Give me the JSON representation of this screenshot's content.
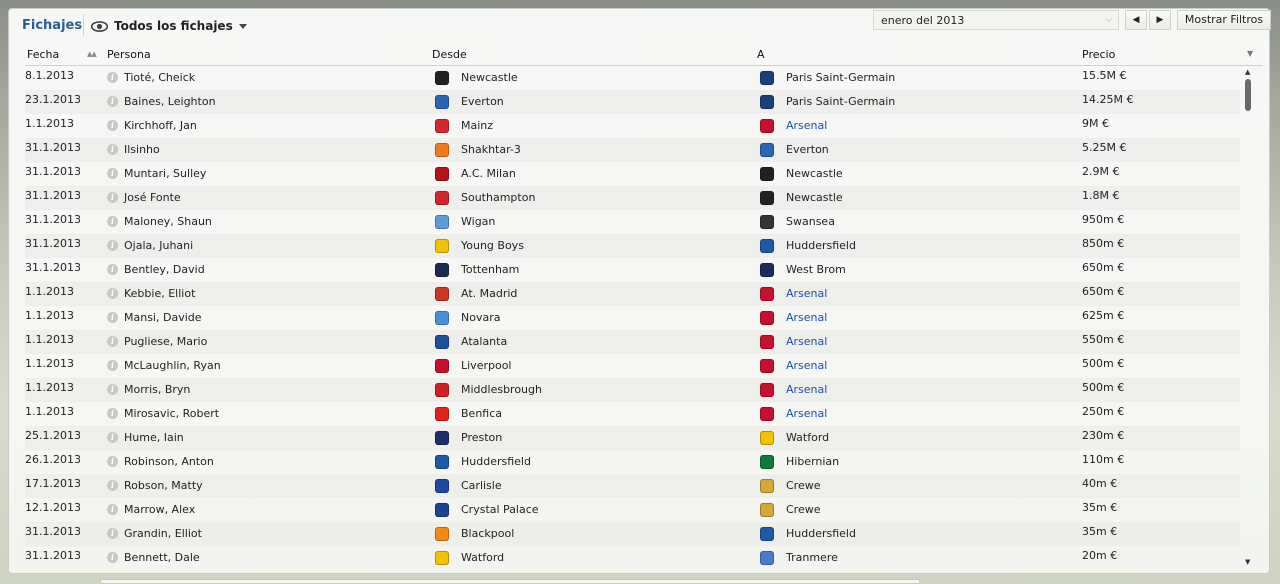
{
  "header": {
    "title": "Fichajes",
    "view_label": "Todos los fichajes",
    "date_value": "enero del 2013",
    "filters_label": "Mostrar Filtros"
  },
  "columns": {
    "date": "Fecha",
    "person": "Persona",
    "from": "Desde",
    "to": "A",
    "fee": "Precio"
  },
  "colors": {
    "accent": "#2b5c95",
    "link": "#1f4fa3"
  },
  "rows": [
    {
      "date": "8.1.2013",
      "person": "Tioté, Cheick",
      "from": "Newcastle",
      "from_color": "#222222",
      "to": "Paris Saint-Germain",
      "to_color": "#1b3f7a",
      "fee": "15.5M €",
      "to_link": false
    },
    {
      "date": "23.1.2013",
      "person": "Baines, Leighton",
      "from": "Everton",
      "from_color": "#2a66b5",
      "to": "Paris Saint-Germain",
      "to_color": "#1b3f7a",
      "fee": "14.25M €",
      "to_link": false
    },
    {
      "date": "1.1.2013",
      "person": "Kirchhoff, Jan",
      "from": "Mainz",
      "from_color": "#d6282e",
      "to": "Arsenal",
      "to_color": "#c8102e",
      "fee": "9M €",
      "to_link": true
    },
    {
      "date": "31.1.2013",
      "person": "Ilsinho",
      "from": "Shakhtar-3",
      "from_color": "#f07a1a",
      "to": "Everton",
      "to_color": "#2a66b5",
      "fee": "5.25M €",
      "to_link": false
    },
    {
      "date": "31.1.2013",
      "person": "Muntari, Sulley",
      "from": "A.C. Milan",
      "from_color": "#b5121b",
      "to": "Newcastle",
      "to_color": "#222222",
      "fee": "2.9M €",
      "to_link": false
    },
    {
      "date": "31.1.2013",
      "person": "José Fonte",
      "from": "Southampton",
      "from_color": "#d2232a",
      "to": "Newcastle",
      "to_color": "#222222",
      "fee": "1.8M €",
      "to_link": false
    },
    {
      "date": "31.1.2013",
      "person": "Maloney, Shaun",
      "from": "Wigan",
      "from_color": "#5d9ad6",
      "to": "Swansea",
      "to_color": "#333333",
      "fee": "950m €",
      "to_link": false
    },
    {
      "date": "31.1.2013",
      "person": "Ojala, Juhani",
      "from": "Young Boys",
      "from_color": "#f2c200",
      "to": "Huddersfield",
      "to_color": "#1e5aa8",
      "fee": "850m €",
      "to_link": false
    },
    {
      "date": "31.1.2013",
      "person": "Bentley, David",
      "from": "Tottenham",
      "from_color": "#1c2a52",
      "to": "West Brom",
      "to_color": "#1b2b5c",
      "fee": "650m €",
      "to_link": false
    },
    {
      "date": "1.1.2013",
      "person": "Kebbie, Elliot",
      "from": "At. Madrid",
      "from_color": "#cb3524",
      "to": "Arsenal",
      "to_color": "#c8102e",
      "fee": "650m €",
      "to_link": true
    },
    {
      "date": "1.1.2013",
      "person": "Mansi, Davide",
      "from": "Novara",
      "from_color": "#4a90d9",
      "to": "Arsenal",
      "to_color": "#c8102e",
      "fee": "625m €",
      "to_link": true
    },
    {
      "date": "1.1.2013",
      "person": "Pugliese, Mario",
      "from": "Atalanta",
      "from_color": "#1c4f9c",
      "to": "Arsenal",
      "to_color": "#c8102e",
      "fee": "550m €",
      "to_link": true
    },
    {
      "date": "1.1.2013",
      "person": "McLaughlin, Ryan",
      "from": "Liverpool",
      "from_color": "#c8102e",
      "to": "Arsenal",
      "to_color": "#c8102e",
      "fee": "500m €",
      "to_link": true
    },
    {
      "date": "1.1.2013",
      "person": "Morris, Bryn",
      "from": "Middlesbrough",
      "from_color": "#d21f26",
      "to": "Arsenal",
      "to_color": "#c8102e",
      "fee": "500m €",
      "to_link": true
    },
    {
      "date": "1.1.2013",
      "person": "Mirosavic, Robert",
      "from": "Benfica",
      "from_color": "#e2231a",
      "to": "Arsenal",
      "to_color": "#c8102e",
      "fee": "250m €",
      "to_link": true
    },
    {
      "date": "25.1.2013",
      "person": "Hume, Iain",
      "from": "Preston",
      "from_color": "#1d2f6b",
      "to": "Watford",
      "to_color": "#f2c200",
      "fee": "230m €",
      "to_link": false
    },
    {
      "date": "26.1.2013",
      "person": "Robinson, Anton",
      "from": "Huddersfield",
      "from_color": "#1e5aa8",
      "to": "Hibernian",
      "to_color": "#0a7a3f",
      "fee": "110m €",
      "to_link": false
    },
    {
      "date": "17.1.2013",
      "person": "Robson, Matty",
      "from": "Carlisle",
      "from_color": "#1d47a1",
      "to": "Crewe",
      "to_color": "#d6a935",
      "fee": "40m €",
      "to_link": false
    },
    {
      "date": "12.1.2013",
      "person": "Marrow, Alex",
      "from": "Crystal Palace",
      "from_color": "#1b458f",
      "to": "Crewe",
      "to_color": "#d6a935",
      "fee": "35m €",
      "to_link": false
    },
    {
      "date": "31.1.2013",
      "person": "Grandin, Elliot",
      "from": "Blackpool",
      "from_color": "#f68712",
      "to": "Huddersfield",
      "to_color": "#1e5aa8",
      "fee": "35m €",
      "to_link": false
    },
    {
      "date": "31.1.2013",
      "person": "Bennett, Dale",
      "from": "Watford",
      "from_color": "#f2c200",
      "to": "Tranmere",
      "to_color": "#4a7bd0",
      "fee": "20m €",
      "to_link": false
    }
  ]
}
